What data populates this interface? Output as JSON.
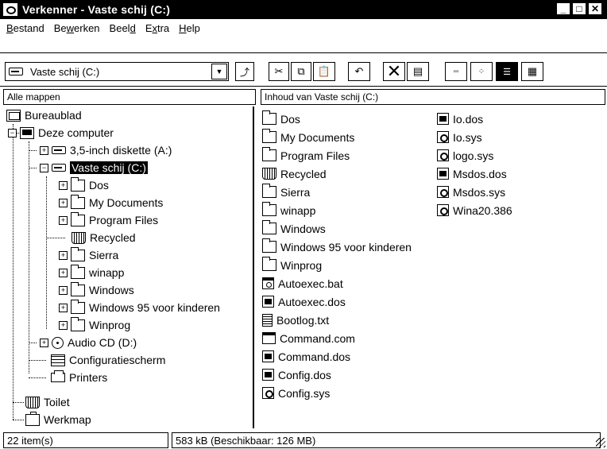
{
  "window": {
    "title": "Verkenner - Vaste schij (C:)",
    "minimize": "_",
    "maximize": "□",
    "close": "✕"
  },
  "menu": [
    {
      "label": "Bestand",
      "underline": "B",
      "rest": "estand"
    },
    {
      "label": "Bewerken",
      "pre": "Be",
      "underline": "w",
      "rest": "erken"
    },
    {
      "label": "Beeld",
      "pre": "Beel",
      "underline": "d",
      "rest": ""
    },
    {
      "label": "Extra",
      "pre": "E",
      "underline": "x",
      "rest": "tra"
    },
    {
      "label": "Help",
      "underline": "H",
      "rest": "elp"
    }
  ],
  "toolbar": {
    "drive_label": "Vaste schij (C:)"
  },
  "left_header": "Alle mappen",
  "right_header": "Inhoud van Vaste schij (C:)",
  "tree": [
    {
      "label": "Bureaublad",
      "icon": "desktop-icon"
    },
    {
      "label": "Deze computer",
      "icon": "computer-icon"
    },
    {
      "label": "3,5-inch diskette (A:)",
      "icon": "floppy-icon"
    },
    {
      "label": "Vaste schij (C:)",
      "icon": "drive-icon",
      "selected": true
    },
    {
      "label": "Dos",
      "icon": "folder-icon"
    },
    {
      "label": "My Documents",
      "icon": "folder-icon"
    },
    {
      "label": "Program Files",
      "icon": "folder-icon"
    },
    {
      "label": "Recycled",
      "icon": "recycle-bin-icon"
    },
    {
      "label": "Sierra",
      "icon": "folder-icon"
    },
    {
      "label": "winapp",
      "icon": "folder-icon"
    },
    {
      "label": "Windows",
      "icon": "folder-icon"
    },
    {
      "label": "Windows 95 voor kinderen",
      "icon": "folder-icon"
    },
    {
      "label": "Winprog",
      "icon": "folder-icon"
    },
    {
      "label": "Audio CD (D:)",
      "icon": "cd-icon"
    },
    {
      "label": "Configuratiescherm",
      "icon": "control-panel-icon"
    },
    {
      "label": "Printers",
      "icon": "printer-icon"
    },
    {
      "label": "Toilet",
      "icon": "recycle-bin-icon"
    },
    {
      "label": "Werkmap",
      "icon": "briefcase-icon"
    }
  ],
  "files_col1": [
    {
      "label": "Dos",
      "icon": "folder-icon"
    },
    {
      "label": "My Documents",
      "icon": "folder-icon"
    },
    {
      "label": "Program Files",
      "icon": "folder-icon"
    },
    {
      "label": "Recycled",
      "icon": "recycle-bin-icon"
    },
    {
      "label": "Sierra",
      "icon": "folder-icon"
    },
    {
      "label": "winapp",
      "icon": "folder-icon"
    },
    {
      "label": "Windows",
      "icon": "folder-icon"
    },
    {
      "label": "Windows 95 voor kinderen",
      "icon": "folder-icon"
    },
    {
      "label": "Winprog",
      "icon": "folder-icon"
    },
    {
      "label": "Autoexec.bat",
      "icon": "batch-file-icon"
    },
    {
      "label": "Autoexec.dos",
      "icon": "dos-file-icon"
    },
    {
      "label": "Bootlog.txt",
      "icon": "text-file-icon"
    },
    {
      "label": "Command.com",
      "icon": "com-file-icon"
    },
    {
      "label": "Command.dos",
      "icon": "dos-file-icon"
    },
    {
      "label": "Config.dos",
      "icon": "dos-file-icon"
    },
    {
      "label": "Config.sys",
      "icon": "system-file-icon"
    }
  ],
  "files_col2": [
    {
      "label": "Io.dos",
      "icon": "dos-file-icon"
    },
    {
      "label": "Io.sys",
      "icon": "system-file-icon"
    },
    {
      "label": "logo.sys",
      "icon": "system-file-icon"
    },
    {
      "label": "Msdos.dos",
      "icon": "dos-file-icon"
    },
    {
      "label": "Msdos.sys",
      "icon": "system-file-icon"
    },
    {
      "label": "Wina20.386",
      "icon": "system-file-icon"
    }
  ],
  "status": {
    "items": "22 item(s)",
    "size": "583 kB (Beschikbaar: 126 MB)"
  }
}
